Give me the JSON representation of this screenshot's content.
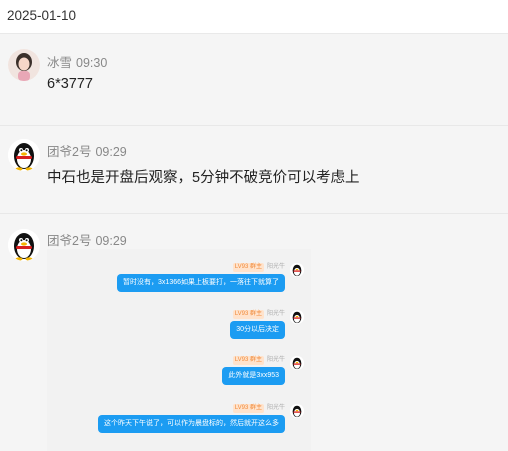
{
  "date_header": "2025-01-10",
  "messages": [
    {
      "name": "冰雪",
      "time": "09:30",
      "text": "6*3777"
    },
    {
      "name": "团爷2号",
      "time": "09:29",
      "text": "中石也是开盘后观察，5分钟不破竞价可以考虑上"
    },
    {
      "name": "团爷2号",
      "time": "09:29"
    }
  ],
  "screenshot": {
    "rows": [
      {
        "badge": "LV93 群主",
        "name": "阳光牛",
        "text": "暂时没有，3x1366如果上板要打，一落往下就算了"
      },
      {
        "badge": "LV93 群主",
        "name": "阳光牛",
        "text": "30分以后决定"
      },
      {
        "badge": "LV93 群主",
        "name": "阳光牛",
        "text": "此外就是3xx953"
      },
      {
        "badge": "LV93 群主",
        "name": "阳光牛",
        "text": "这个昨天下午说了，可以作为晨盘标的，然后就开这么多"
      }
    ]
  },
  "colors": {
    "bubble": "#1c9cf2",
    "badge_bg": "#ffe3cc",
    "badge_text": "#f08a3a"
  }
}
